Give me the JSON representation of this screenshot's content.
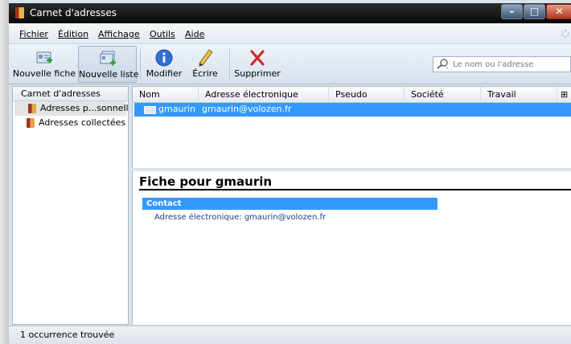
{
  "window": {
    "title": "Carnet d'adresses"
  },
  "menu": [
    "Fichier",
    "Édition",
    "Affichage",
    "Outils",
    "Aide"
  ],
  "toolbar": {
    "new_card": "Nouvelle fiche",
    "new_list": "Nouvelle liste",
    "edit": "Modifier",
    "write": "Écrire",
    "delete": "Supprimer",
    "search_placeholder": "Le nom ou l'adresse"
  },
  "sidebar": {
    "header": "Carnet d'adresses",
    "books": [
      "Adresses p...sonnelles",
      "Adresses collectées"
    ]
  },
  "list": {
    "columns": [
      "Nom",
      "Adresse électronique",
      "Pseudo",
      "Société",
      "Travail"
    ],
    "rows": [
      {
        "name": "gmaurin",
        "email": "gmaurin@volozen.fr"
      }
    ]
  },
  "detail": {
    "heading": "Fiche pour gmaurin",
    "section": "Contact",
    "email_line": "Adresse électronique: gmaurin@volozen.fr"
  },
  "status": {
    "text": "1 occurrence trouvée"
  },
  "colors": {
    "selection": "#3399ff",
    "titlebar": "#0a0a0a",
    "delete_icon": "#d82626",
    "info_icon": "#2f6fd6"
  }
}
